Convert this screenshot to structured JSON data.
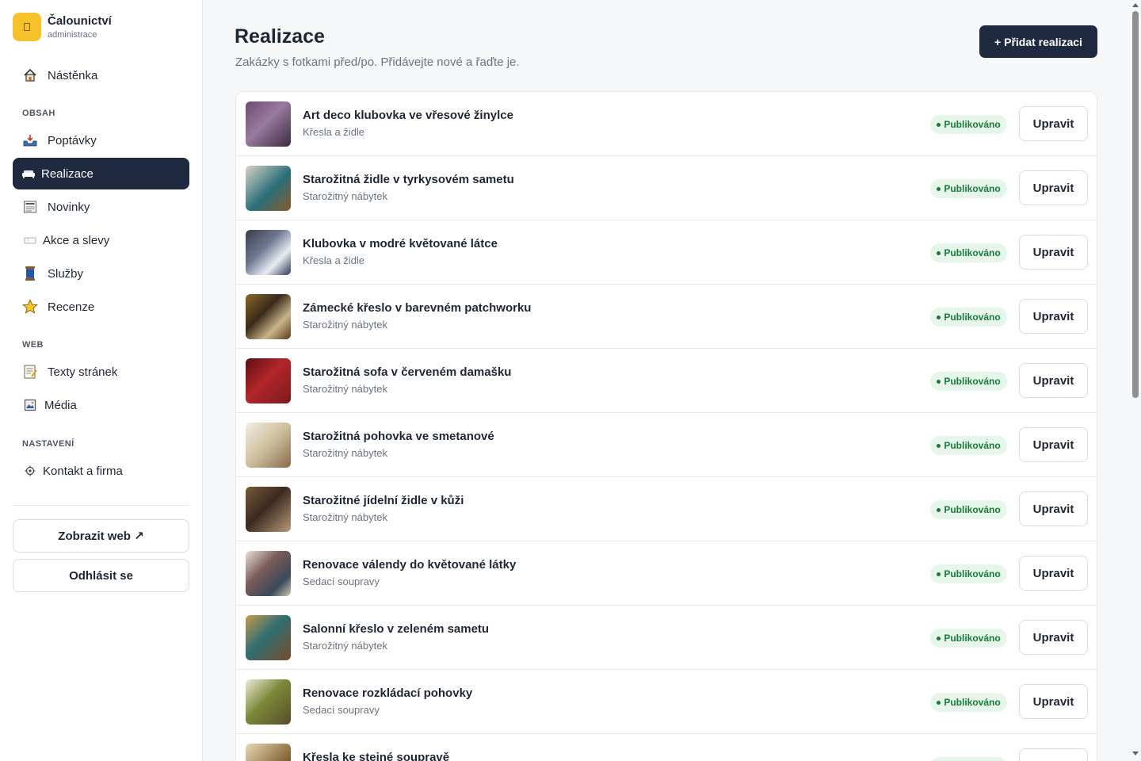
{
  "brand": {
    "name": "Čalounictví",
    "subtitle": "administrace"
  },
  "sidebar": {
    "top_items": [
      {
        "label": "Nástěnka",
        "icon": "home-icon"
      }
    ],
    "sections": [
      {
        "label": "OBSAH",
        "items": [
          {
            "label": "Poptávky",
            "icon": "inbox-tray-icon"
          },
          {
            "label": "Realizace",
            "icon": "sofa-icon",
            "active": true
          },
          {
            "label": "Novinky",
            "icon": "newspaper-icon"
          },
          {
            "label": "Akce a slevy",
            "icon": "ticket-icon"
          },
          {
            "label": "Služby",
            "icon": "thread-spool-icon"
          },
          {
            "label": "Recenze",
            "icon": "star-icon"
          }
        ]
      },
      {
        "label": "WEB",
        "items": [
          {
            "label": "Texty stránek",
            "icon": "memo-icon"
          },
          {
            "label": "Média",
            "icon": "image-frame-icon"
          }
        ]
      },
      {
        "label": "NASTAVENÍ",
        "items": [
          {
            "label": "Kontakt a firma",
            "icon": "gear-icon"
          }
        ]
      }
    ],
    "view_site": "Zobrazit web ↗",
    "logout": "Odhlásit se"
  },
  "main": {
    "title": "Realizace",
    "subtitle": "Zakázky s fotkami před/po. Přidávejte nové a řaďte je.",
    "add_button": "+ Přidat realizaci",
    "status_label": "Publikováno",
    "edit_label": "Upravit",
    "items": [
      {
        "title": "Art deco klubovka ve vřesové žinylce",
        "category": "Křesla a židle"
      },
      {
        "title": "Starožitná židle v tyrkysovém sametu",
        "category": "Starožitný nábytek"
      },
      {
        "title": "Klubovka v modré květované látce",
        "category": "Křesla a židle"
      },
      {
        "title": "Zámecké křeslo v barevném patchworku",
        "category": "Starožitný nábytek"
      },
      {
        "title": "Starožitná sofa v červeném damašku",
        "category": "Starožitný nábytek"
      },
      {
        "title": "Starožitná pohovka ve smetanové",
        "category": "Starožitný nábytek"
      },
      {
        "title": "Starožitné jídelní židle v kůži",
        "category": "Starožitný nábytek"
      },
      {
        "title": "Renovace válendy do květované látky",
        "category": "Sedací soupravy"
      },
      {
        "title": "Salonní křeslo v zeleném sametu",
        "category": "Starožitný nábytek"
      },
      {
        "title": "Renovace rozkládací pohovky",
        "category": "Sedací soupravy"
      },
      {
        "title": "Křesla ke stejné soupravě",
        "category": ""
      }
    ]
  },
  "colors": {
    "sidebar_active": "#1f2940",
    "brand_logo": "#f6c12a",
    "badge_bg": "#e6f6ea",
    "badge_text": "#1a7a3a"
  }
}
